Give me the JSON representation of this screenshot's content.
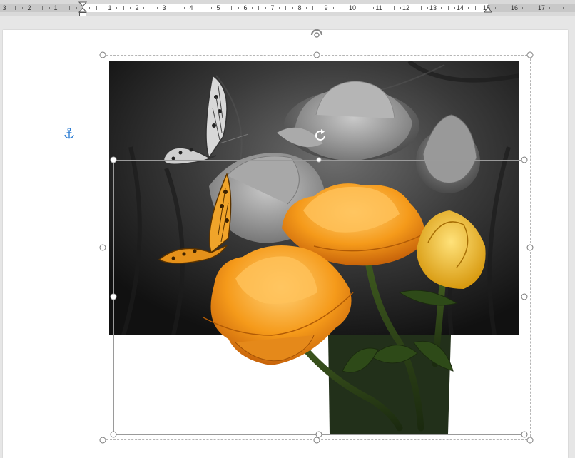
{
  "ruler": {
    "numbers": [
      "3",
      "2",
      "1",
      "1",
      "2",
      "3",
      "4",
      "5",
      "6",
      "7",
      "8",
      "9",
      "10",
      "11",
      "12",
      "13",
      "14",
      "15",
      "16",
      "17"
    ]
  },
  "icons": {
    "anchor": "anchor-icon",
    "rotate": "rotate-icon",
    "wrap": "layout-options-icon"
  },
  "colors": {
    "anchor": "#2b7cd3",
    "flower_orange": "#f59a1a",
    "handle_border": "#7a7a7a"
  }
}
